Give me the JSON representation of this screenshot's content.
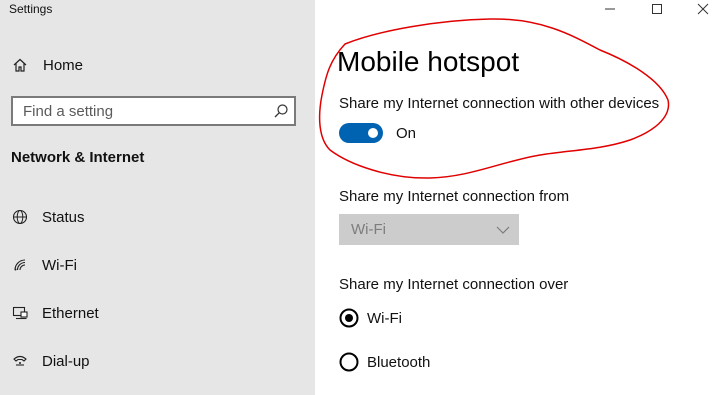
{
  "window": {
    "title": "Settings"
  },
  "sidebar": {
    "home_label": "Home",
    "search_placeholder": "Find a setting",
    "section_title": "Network & Internet",
    "items": [
      {
        "label": "Status",
        "icon": "globe-icon"
      },
      {
        "label": "Wi-Fi",
        "icon": "wifi-icon"
      },
      {
        "label": "Ethernet",
        "icon": "ethernet-icon"
      },
      {
        "label": "Dial-up",
        "icon": "dialup-icon"
      }
    ]
  },
  "main": {
    "title": "Mobile hotspot",
    "share_label": "Share my Internet connection with other devices",
    "toggle_state": "On",
    "from_label": "Share my Internet connection from",
    "from_value": "Wi-Fi",
    "over_label": "Share my Internet connection over",
    "over_options": [
      {
        "label": "Wi-Fi",
        "selected": true
      },
      {
        "label": "Bluetooth",
        "selected": false
      }
    ]
  },
  "colors": {
    "sidebar_bg": "#e6e6e6",
    "accent": "#0063b1",
    "annotation": "#e00000"
  }
}
